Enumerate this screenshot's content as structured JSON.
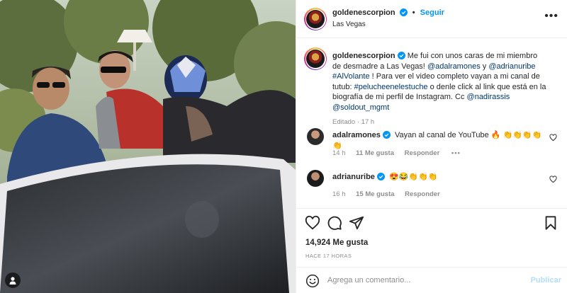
{
  "post": {
    "photo_alt": "",
    "author": "goldenescorpion",
    "follow_label": "Seguir",
    "location": "Las Vegas"
  },
  "caption": {
    "author": "goldenescorpion",
    "text_1": "Me fui con unos caras de mi miembro de desmadre a Las Vegas! ",
    "mention_1": "@adalramones",
    "text_2": " y ",
    "mention_2": "@adrianuribe",
    "text_3": " ",
    "hashtag_1": "#AlVolante",
    "text_4": " ! Para ver el video completo vayan a mi canal de tutub: ",
    "hashtag_2": "#peluchee nelestuche",
    "text_5": " o denle click al link que está en la biografía de mi perfil de Instagram. Cc ",
    "mention_3": "@nadirassis",
    "text_6": " ",
    "mention_4": "@soldout_mgmt",
    "edited": "Editado",
    "time": "17 h"
  },
  "comments": [
    {
      "user": "adalramones",
      "text": "Vayan al canal de YouTube 🔥 👏👏👏👏👏",
      "time": "14 h",
      "likes": "11 Me gusta",
      "reply": "Responder"
    },
    {
      "user": "adrianuribe",
      "text": "😍😂👏👏👏",
      "time": "16 h",
      "likes": "15 Me gusta",
      "reply": "Responder"
    }
  ],
  "actions": {
    "likes": "14,924 Me gusta",
    "time_ago": "HACE 17 HORAS"
  },
  "add_comment": {
    "placeholder": "Agrega un comentario...",
    "post_label": "Publicar"
  },
  "colors": {
    "accent": "#0095f6",
    "link": "#00376b",
    "muted": "#8e8e8e",
    "post_disabled": "#b2dffc"
  }
}
